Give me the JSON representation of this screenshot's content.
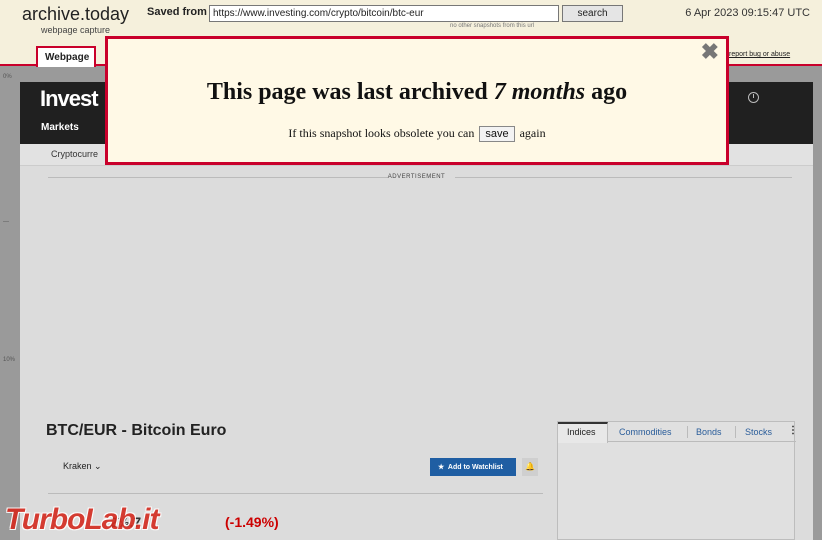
{
  "archive": {
    "logo_title": "archive.today",
    "logo_sub": "webpage capture",
    "saved_from_label": "Saved from",
    "url_value": "https://www.investing.com/crypto/bitcoin/btc-eur",
    "search_label": "search",
    "no_other_snapshots": "no other snapshots from this url",
    "date": "6 Apr 2023 09:15:47 UTC",
    "tab_webpage": "Webpage",
    "report_link": "report bug or abuse",
    "left_marks": [
      "0%",
      "—",
      "10%"
    ]
  },
  "snapshot": {
    "logo": "Invest",
    "nav_markets": "Markets",
    "subnav_crypto": "Cryptocurre",
    "ad_label": "ADVERTISEMENT",
    "title": "BTC/EUR - Bitcoin Euro",
    "exchange": "Kraken ⌄",
    "watchlist_button": "Add to Watchlist",
    "price_partial": "2⅓.7",
    "price_change": "(-1.49%)",
    "side_tabs": [
      "Indices",
      "Commodities",
      "Bonds",
      "Stocks"
    ],
    "side_more": "⋮"
  },
  "modal": {
    "headline_prefix": "This page was last archived",
    "headline_emphasis": "7 months",
    "headline_suffix": "ago",
    "line_prefix": "If this snapshot looks obsolete you can",
    "save_label": "save",
    "line_suffix": "again",
    "close_symbol": "✖"
  },
  "watermark": "TurboLab.it",
  "colors": {
    "archive_red": "#c9002b",
    "modal_bg": "#fff9e6",
    "nav_dark": "#202020",
    "watchlist_blue": "#1f5ea3",
    "change_red": "#cc0000"
  }
}
